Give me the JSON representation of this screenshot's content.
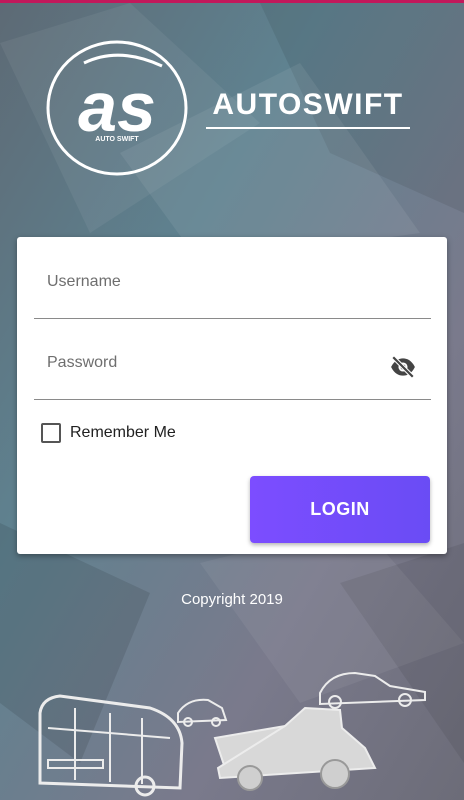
{
  "brand": {
    "logo_monogram": "as",
    "logo_caption": "AUTO SWIFT",
    "name": "AUTOSWIFT"
  },
  "login_form": {
    "username_placeholder": "Username",
    "password_placeholder": "Password",
    "remember_me_label": "Remember Me",
    "remember_me_checked": false,
    "login_button_label": "LOGIN"
  },
  "footer": {
    "copyright": "Copyright 2019"
  },
  "colors": {
    "accent_top_bar": "#c2185b",
    "login_button": "#7c4dff",
    "card": "#ffffff"
  },
  "icons": [
    "eye-off-icon",
    "checkbox-icon",
    "autoswift-logo",
    "vehicles-illustration"
  ]
}
